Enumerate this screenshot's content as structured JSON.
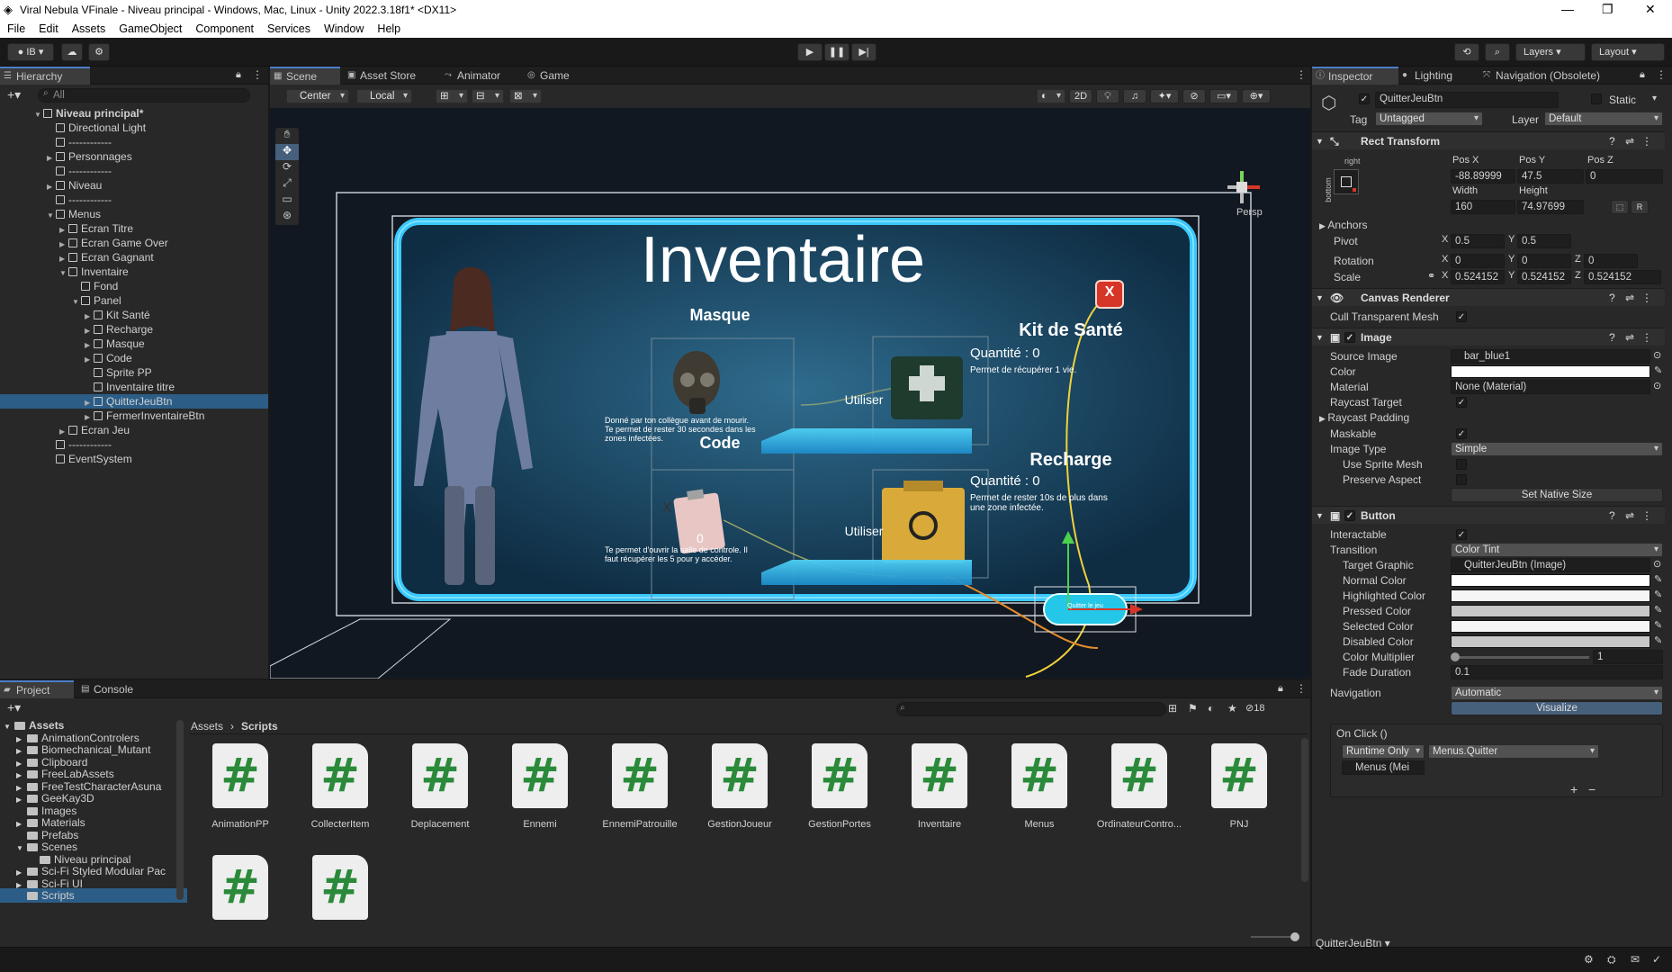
{
  "window": {
    "title": "Viral Nebula VFinale - Niveau principal - Windows, Mac, Linux - Unity 2022.3.18f1* <DX11>"
  },
  "menu": [
    "File",
    "Edit",
    "Assets",
    "GameObject",
    "Component",
    "Services",
    "Window",
    "Help"
  ],
  "toolbar": {
    "account": "IB",
    "layers": "Layers",
    "layout": "Layout"
  },
  "hierarchy": {
    "tab": "Hierarchy",
    "search_placeholder": "All",
    "items": [
      {
        "label": "Niveau principal*",
        "depth": 0,
        "arrow": "▼",
        "scene": true
      },
      {
        "label": "Directional Light",
        "depth": 1,
        "arrow": ""
      },
      {
        "label": "------------",
        "depth": 1,
        "arrow": ""
      },
      {
        "label": "Personnages",
        "depth": 1,
        "arrow": "▶"
      },
      {
        "label": "------------",
        "depth": 1,
        "arrow": ""
      },
      {
        "label": "Niveau",
        "depth": 1,
        "arrow": "▶"
      },
      {
        "label": "------------",
        "depth": 1,
        "arrow": ""
      },
      {
        "label": "Menus",
        "depth": 1,
        "arrow": "▼"
      },
      {
        "label": "Ecran Titre",
        "depth": 2,
        "arrow": "▶"
      },
      {
        "label": "Ecran Game Over",
        "depth": 2,
        "arrow": "▶"
      },
      {
        "label": "Ecran Gagnant",
        "depth": 2,
        "arrow": "▶"
      },
      {
        "label": "Inventaire",
        "depth": 2,
        "arrow": "▼"
      },
      {
        "label": "Fond",
        "depth": 3,
        "arrow": ""
      },
      {
        "label": "Panel",
        "depth": 3,
        "arrow": "▼"
      },
      {
        "label": "Kit Santé",
        "depth": 4,
        "arrow": "▶"
      },
      {
        "label": "Recharge",
        "depth": 4,
        "arrow": "▶"
      },
      {
        "label": "Masque",
        "depth": 4,
        "arrow": "▶"
      },
      {
        "label": "Code",
        "depth": 4,
        "arrow": "▶"
      },
      {
        "label": "Sprite PP",
        "depth": 4,
        "arrow": ""
      },
      {
        "label": "Inventaire titre",
        "depth": 4,
        "arrow": ""
      },
      {
        "label": "QuitterJeuBtn",
        "depth": 4,
        "arrow": "▶",
        "selected": true
      },
      {
        "label": "FermerInventaireBtn",
        "depth": 4,
        "arrow": "▶"
      },
      {
        "label": "Ecran Jeu",
        "depth": 2,
        "arrow": "▶"
      },
      {
        "label": "------------",
        "depth": 1,
        "arrow": ""
      },
      {
        "label": "EventSystem",
        "depth": 1,
        "arrow": ""
      }
    ]
  },
  "scene": {
    "tabs": [
      "Scene",
      "Asset Store",
      "Animator",
      "Game"
    ],
    "pivot": "Center",
    "space": "Local",
    "mode2d": "2D",
    "persp": "Persp",
    "ui": {
      "title": "Inventaire",
      "masque": "Masque",
      "masque_desc": "Donné par ton collègue avant de mourir. Te permet de rester 30 secondes dans les zones infectées.",
      "code": "Code",
      "code_count": "0",
      "code_desc": "Te permet d'ouvrir la salle de controle. Il faut récupérer les 5 pour y accéder.",
      "kit_title": "Kit de Santé",
      "kit_qty": "Quantité :  0",
      "kit_desc": "Permet de récupérer 1 vie.",
      "recharge_title": "Recharge",
      "recharge_qty": "Quantité :  0",
      "recharge_desc": "Permet de rester 10s de plus dans une zone infectée.",
      "use1": "Utiliser",
      "use2": "Utiliser",
      "quit": "Quitter le jeu",
      "close": "X",
      "clipboard_x": "X"
    }
  },
  "inspector": {
    "tabs": [
      "Inspector",
      "Lighting",
      "Navigation (Obsolete)"
    ],
    "object_name": "QuitterJeuBtn",
    "static": "Static",
    "tag_label": "Tag",
    "tag": "Untagged",
    "layer_label": "Layer",
    "layer": "Default",
    "rect": {
      "title": "Rect Transform",
      "anchor_h": "right",
      "anchor_v": "bottom",
      "posx_label": "Pos X",
      "posy_label": "Pos Y",
      "posz_label": "Pos Z",
      "posx": "-88.89999",
      "posy": "47.5",
      "posz": "0",
      "width_label": "Width",
      "height_label": "Height",
      "width": "160",
      "height": "74.97699",
      "anchors": "Anchors",
      "pivot": "Pivot",
      "pivot_x": "0.5",
      "pivot_y": "0.5",
      "rotation": "Rotation",
      "rot_x": "0",
      "rot_y": "0",
      "rot_z": "0",
      "scale": "Scale",
      "scale_x": "0.524152",
      "scale_y": "0.524152",
      "scale_z": "0.524152"
    },
    "canvas": {
      "title": "Canvas Renderer",
      "cull": "Cull Transparent Mesh"
    },
    "image": {
      "title": "Image",
      "source_label": "Source Image",
      "source": "bar_blue1",
      "color": "Color",
      "material_label": "Material",
      "material": "None (Material)",
      "raycast": "Raycast Target",
      "raycast_padding": "Raycast Padding",
      "maskable": "Maskable",
      "type_label": "Image Type",
      "type": "Simple",
      "sprite_mesh": "Use Sprite Mesh",
      "preserve": "Preserve Aspect",
      "native": "Set Native Size"
    },
    "button": {
      "title": "Button",
      "interactable": "Interactable",
      "transition_label": "Transition",
      "transition": "Color Tint",
      "target_label": "Target Graphic",
      "target": "QuitterJeuBtn (Image)",
      "normal": "Normal Color",
      "highlighted": "Highlighted Color",
      "pressed": "Pressed Color",
      "selected": "Selected Color",
      "disabled": "Disabled Color",
      "multiplier": "Color Multiplier",
      "multiplier_val": "1",
      "fade": "Fade Duration",
      "fade_val": "0.1",
      "navigation_label": "Navigation",
      "navigation": "Automatic",
      "visualize": "Visualize",
      "onclick": "On Click ()",
      "runtime": "Runtime Only",
      "method": "Menus.Quitter",
      "object": "Menus (Mei"
    }
  },
  "project": {
    "tabs": [
      "Project",
      "Console"
    ],
    "breadcrumb": [
      "Assets",
      "Scripts"
    ],
    "hidden_count": "18",
    "tree": [
      {
        "label": "Assets",
        "depth": 0,
        "arrow": "▼",
        "bold": true
      },
      {
        "label": "AnimationControlers",
        "depth": 1,
        "arrow": "▶"
      },
      {
        "label": "Biomechanical_Mutant",
        "depth": 1,
        "arrow": "▶"
      },
      {
        "label": "Clipboard",
        "depth": 1,
        "arrow": "▶"
      },
      {
        "label": "FreeLabAssets",
        "depth": 1,
        "arrow": "▶"
      },
      {
        "label": "FreeTestCharacterAsuna",
        "depth": 1,
        "arrow": "▶"
      },
      {
        "label": "GeeKay3D",
        "depth": 1,
        "arrow": "▶"
      },
      {
        "label": "Images",
        "depth": 1,
        "arrow": ""
      },
      {
        "label": "Materials",
        "depth": 1,
        "arrow": "▶"
      },
      {
        "label": "Prefabs",
        "depth": 1,
        "arrow": ""
      },
      {
        "label": "Scenes",
        "depth": 1,
        "arrow": "▼"
      },
      {
        "label": "Niveau principal",
        "depth": 2,
        "arrow": ""
      },
      {
        "label": "Sci-Fi Styled Modular Pac",
        "depth": 1,
        "arrow": "▶"
      },
      {
        "label": "Sci-Fi UI",
        "depth": 1,
        "arrow": "▶"
      },
      {
        "label": "Scripts",
        "depth": 1,
        "arrow": "",
        "selected": true
      }
    ],
    "scripts": [
      "AnimationPP",
      "CollecterItem",
      "Deplacement",
      "Ennemi",
      "EnnemiPatrouille",
      "GestionJoueur",
      "GestionPortes",
      "Inventaire",
      "Menus",
      "OrdinateurContro...",
      "PNJ",
      "",
      ""
    ]
  },
  "status": {
    "selection": "QuitterJeuBtn"
  }
}
